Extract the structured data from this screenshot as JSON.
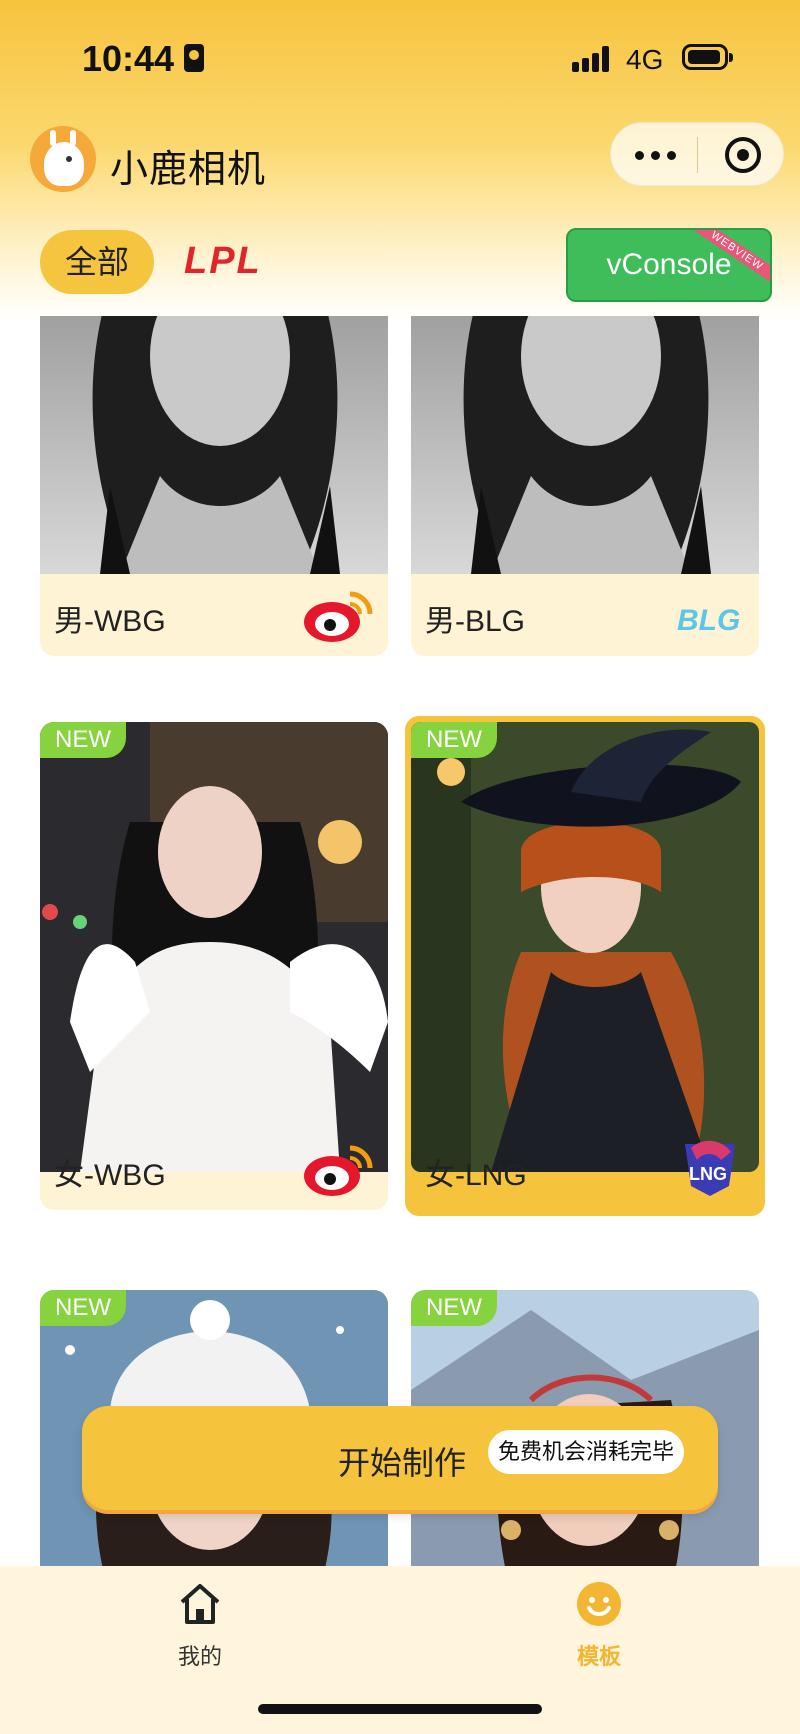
{
  "status_bar": {
    "time": "10:44",
    "network": "4G"
  },
  "app": {
    "title": "小鹿相机"
  },
  "categories": {
    "all": "全部",
    "lpl": "LPL"
  },
  "vconsole": {
    "label": "vConsole",
    "ribbon": "WEBVIEW"
  },
  "templates": [
    {
      "label": "男-WBG",
      "team_icon": "weibo-icon",
      "is_new": false,
      "selected": false
    },
    {
      "label": "男-BLG",
      "team_icon": "blg-logo-icon",
      "is_new": false,
      "selected": false
    },
    {
      "label": "女-WBG",
      "team_icon": "weibo-icon",
      "is_new": true,
      "badge": "NEW",
      "selected": false
    },
    {
      "label": "女-LNG",
      "team_icon": "lng-logo-icon",
      "is_new": true,
      "badge": "NEW",
      "selected": true
    },
    {
      "label": "",
      "is_new": true,
      "badge": "NEW",
      "selected": false
    },
    {
      "label": "",
      "is_new": true,
      "badge": "NEW",
      "selected": false
    }
  ],
  "start_button": {
    "label": "开始制作",
    "badge": "免费机会消耗完毕"
  },
  "tabbar": [
    {
      "label": "我的",
      "icon": "home-icon",
      "active": false
    },
    {
      "label": "模板",
      "icon": "smile-icon",
      "active": true
    }
  ],
  "colors": {
    "accent": "#f6c33c",
    "new_badge": "#86d33f",
    "active_tab": "#f2b632"
  }
}
